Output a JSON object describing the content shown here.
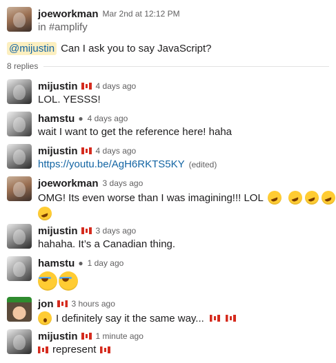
{
  "root": {
    "author": "joeworkman",
    "timestamp": "Mar 2nd at 12:12 PM",
    "channel": "in #amplify",
    "mention": "@mijustin",
    "text": "Can I ask you to say JavaScript?"
  },
  "thread": {
    "replies_label": "8 replies"
  },
  "replies": [
    {
      "author": "mijustin",
      "time": "4 days ago",
      "text": "LOL. YESSS!"
    },
    {
      "author": "hamstu",
      "time": "4 days ago",
      "text": "wait I want to get the reference here! haha"
    },
    {
      "author": "mijustin",
      "time": "4 days ago",
      "link": "https://youtu.be/AgH6RKTS5KY",
      "edited": "(edited)"
    },
    {
      "author": "joeworkman",
      "time": "3 days ago",
      "text": "OMG! Its even worse than I was imagining!!! LOL"
    },
    {
      "author": "mijustin",
      "time": "3 days ago",
      "text": "hahaha. It’s a Canadian thing."
    },
    {
      "author": "hamstu",
      "time": "1 day ago"
    },
    {
      "author": "jon",
      "time": "3 hours ago",
      "text": "I definitely say it the same way..."
    },
    {
      "author": "mijustin",
      "time": "1 minute ago",
      "text": "represent"
    }
  ],
  "icons": {
    "flag": "flag-ca-icon",
    "speaking": "speaking-head-icon",
    "rofl": "rolling-on-floor-laughing-icon",
    "joy": "face-with-tears-of-joy-icon",
    "open_mouth": "face-with-open-mouth-icon"
  },
  "colors": {
    "link": "#1264a3",
    "mention_bg": "#fcefc0",
    "flag_red": "#d52b1e"
  }
}
